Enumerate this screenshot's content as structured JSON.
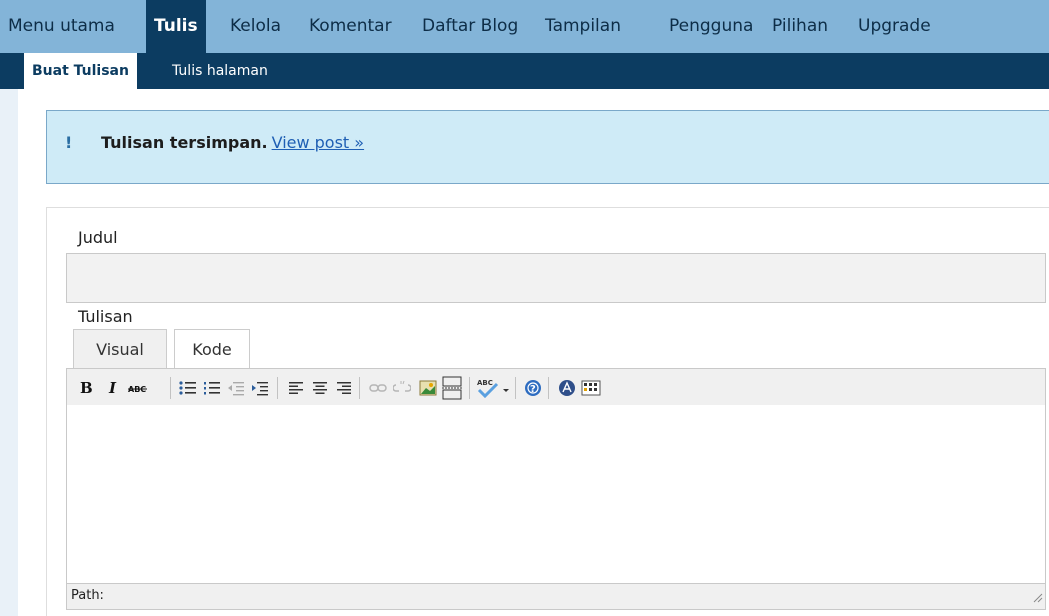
{
  "topnav": {
    "items": [
      "Menu utama",
      "Tulis",
      "Kelola",
      "Komentar",
      "Daftar Blog",
      "Tampilan",
      "Pengguna",
      "Pilihan",
      "Upgrade"
    ]
  },
  "subnav": {
    "items": [
      "Buat Tulisan",
      "Tulis halaman"
    ]
  },
  "notice": {
    "icon_text": "!",
    "message": "Tulisan tersimpan.",
    "link": "View post »"
  },
  "form": {
    "title_label": "Judul",
    "title_value": "",
    "content_label": "Tulisan",
    "tabs": [
      "Visual",
      "Kode"
    ],
    "path_label": "Path:"
  },
  "toolbar": {
    "buttons": [
      "bold-icon",
      "italic-icon",
      "strikethrough-icon",
      "bullet-list-icon",
      "numbered-list-icon",
      "outdent-icon",
      "indent-icon",
      "align-left-icon",
      "align-center-icon",
      "align-right-icon",
      "link-icon",
      "unlink-icon",
      "image-icon",
      "more-tag-icon",
      "spellcheck-icon",
      "help-icon",
      "toggle-advanced-icon",
      "kitchen-sink-icon"
    ]
  },
  "colors": {
    "topnav_bg": "#83b4d8",
    "active_bg": "#0c3c61",
    "notice_bg": "#cfebf7",
    "link": "#1f5fb4"
  }
}
